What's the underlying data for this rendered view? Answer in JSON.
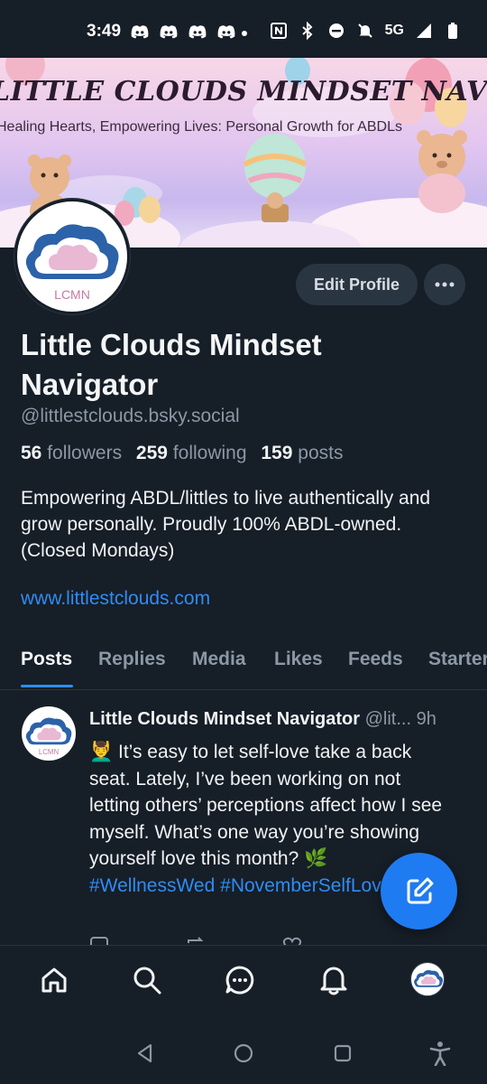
{
  "status_bar": {
    "time": "3:49",
    "network": "5G",
    "left_icons": [
      "discord-icon",
      "discord-icon",
      "discord-icon",
      "discord-icon"
    ],
    "right_icons": [
      "nfc-icon",
      "bluetooth-icon",
      "do-not-disturb-icon",
      "notifications-off-icon",
      "signal-icon",
      "battery-icon"
    ]
  },
  "banner": {
    "title": "LITTLE CLOUDS MINDSET NAVIGATOR",
    "subtitle": "Healing Hearts, Empowering Lives: Personal Growth for ABDLs"
  },
  "profile": {
    "avatar_label": "LCMN",
    "edit_button": "Edit Profile",
    "display_name": "Little Clouds Mindset Navigator",
    "handle": "@littlestclouds.bsky.social",
    "stats": {
      "followers_count": "56",
      "followers_label": "followers",
      "following_count": "259",
      "following_label": "following",
      "posts_count": "159",
      "posts_label": "posts"
    },
    "bio": "Empowering ABDL/littles to live authentically and grow personally. Proudly 100% ABDL-owned. (Closed Mondays)",
    "website": "www.littlestclouds.com"
  },
  "tabs": [
    {
      "label": "Posts",
      "active": true
    },
    {
      "label": "Replies",
      "active": false
    },
    {
      "label": "Media",
      "active": false
    },
    {
      "label": "Likes",
      "active": false
    },
    {
      "label": "Feeds",
      "active": false
    },
    {
      "label": "Starter",
      "active": false
    }
  ],
  "post": {
    "author": "Little Clouds Mindset Navigator",
    "handle_truncated": "@lit...",
    "time": "9h",
    "emoji": "💆‍♂️",
    "text": "It’s easy to let self-love take a back seat. Lately, I’ve been working on not letting others’ perceptions affect how I see myself. What’s one way you’re showing yourself love this month?",
    "emoji2": "🌿",
    "hashtag1": "#WellnessWed",
    "hashtag2": "#NovemberSelfLove"
  },
  "colors": {
    "background": "#161e27",
    "accent": "#2f8cf4",
    "muted": "#8b98a5",
    "button_bg": "#2a3542",
    "fab": "#1f7bf2"
  }
}
